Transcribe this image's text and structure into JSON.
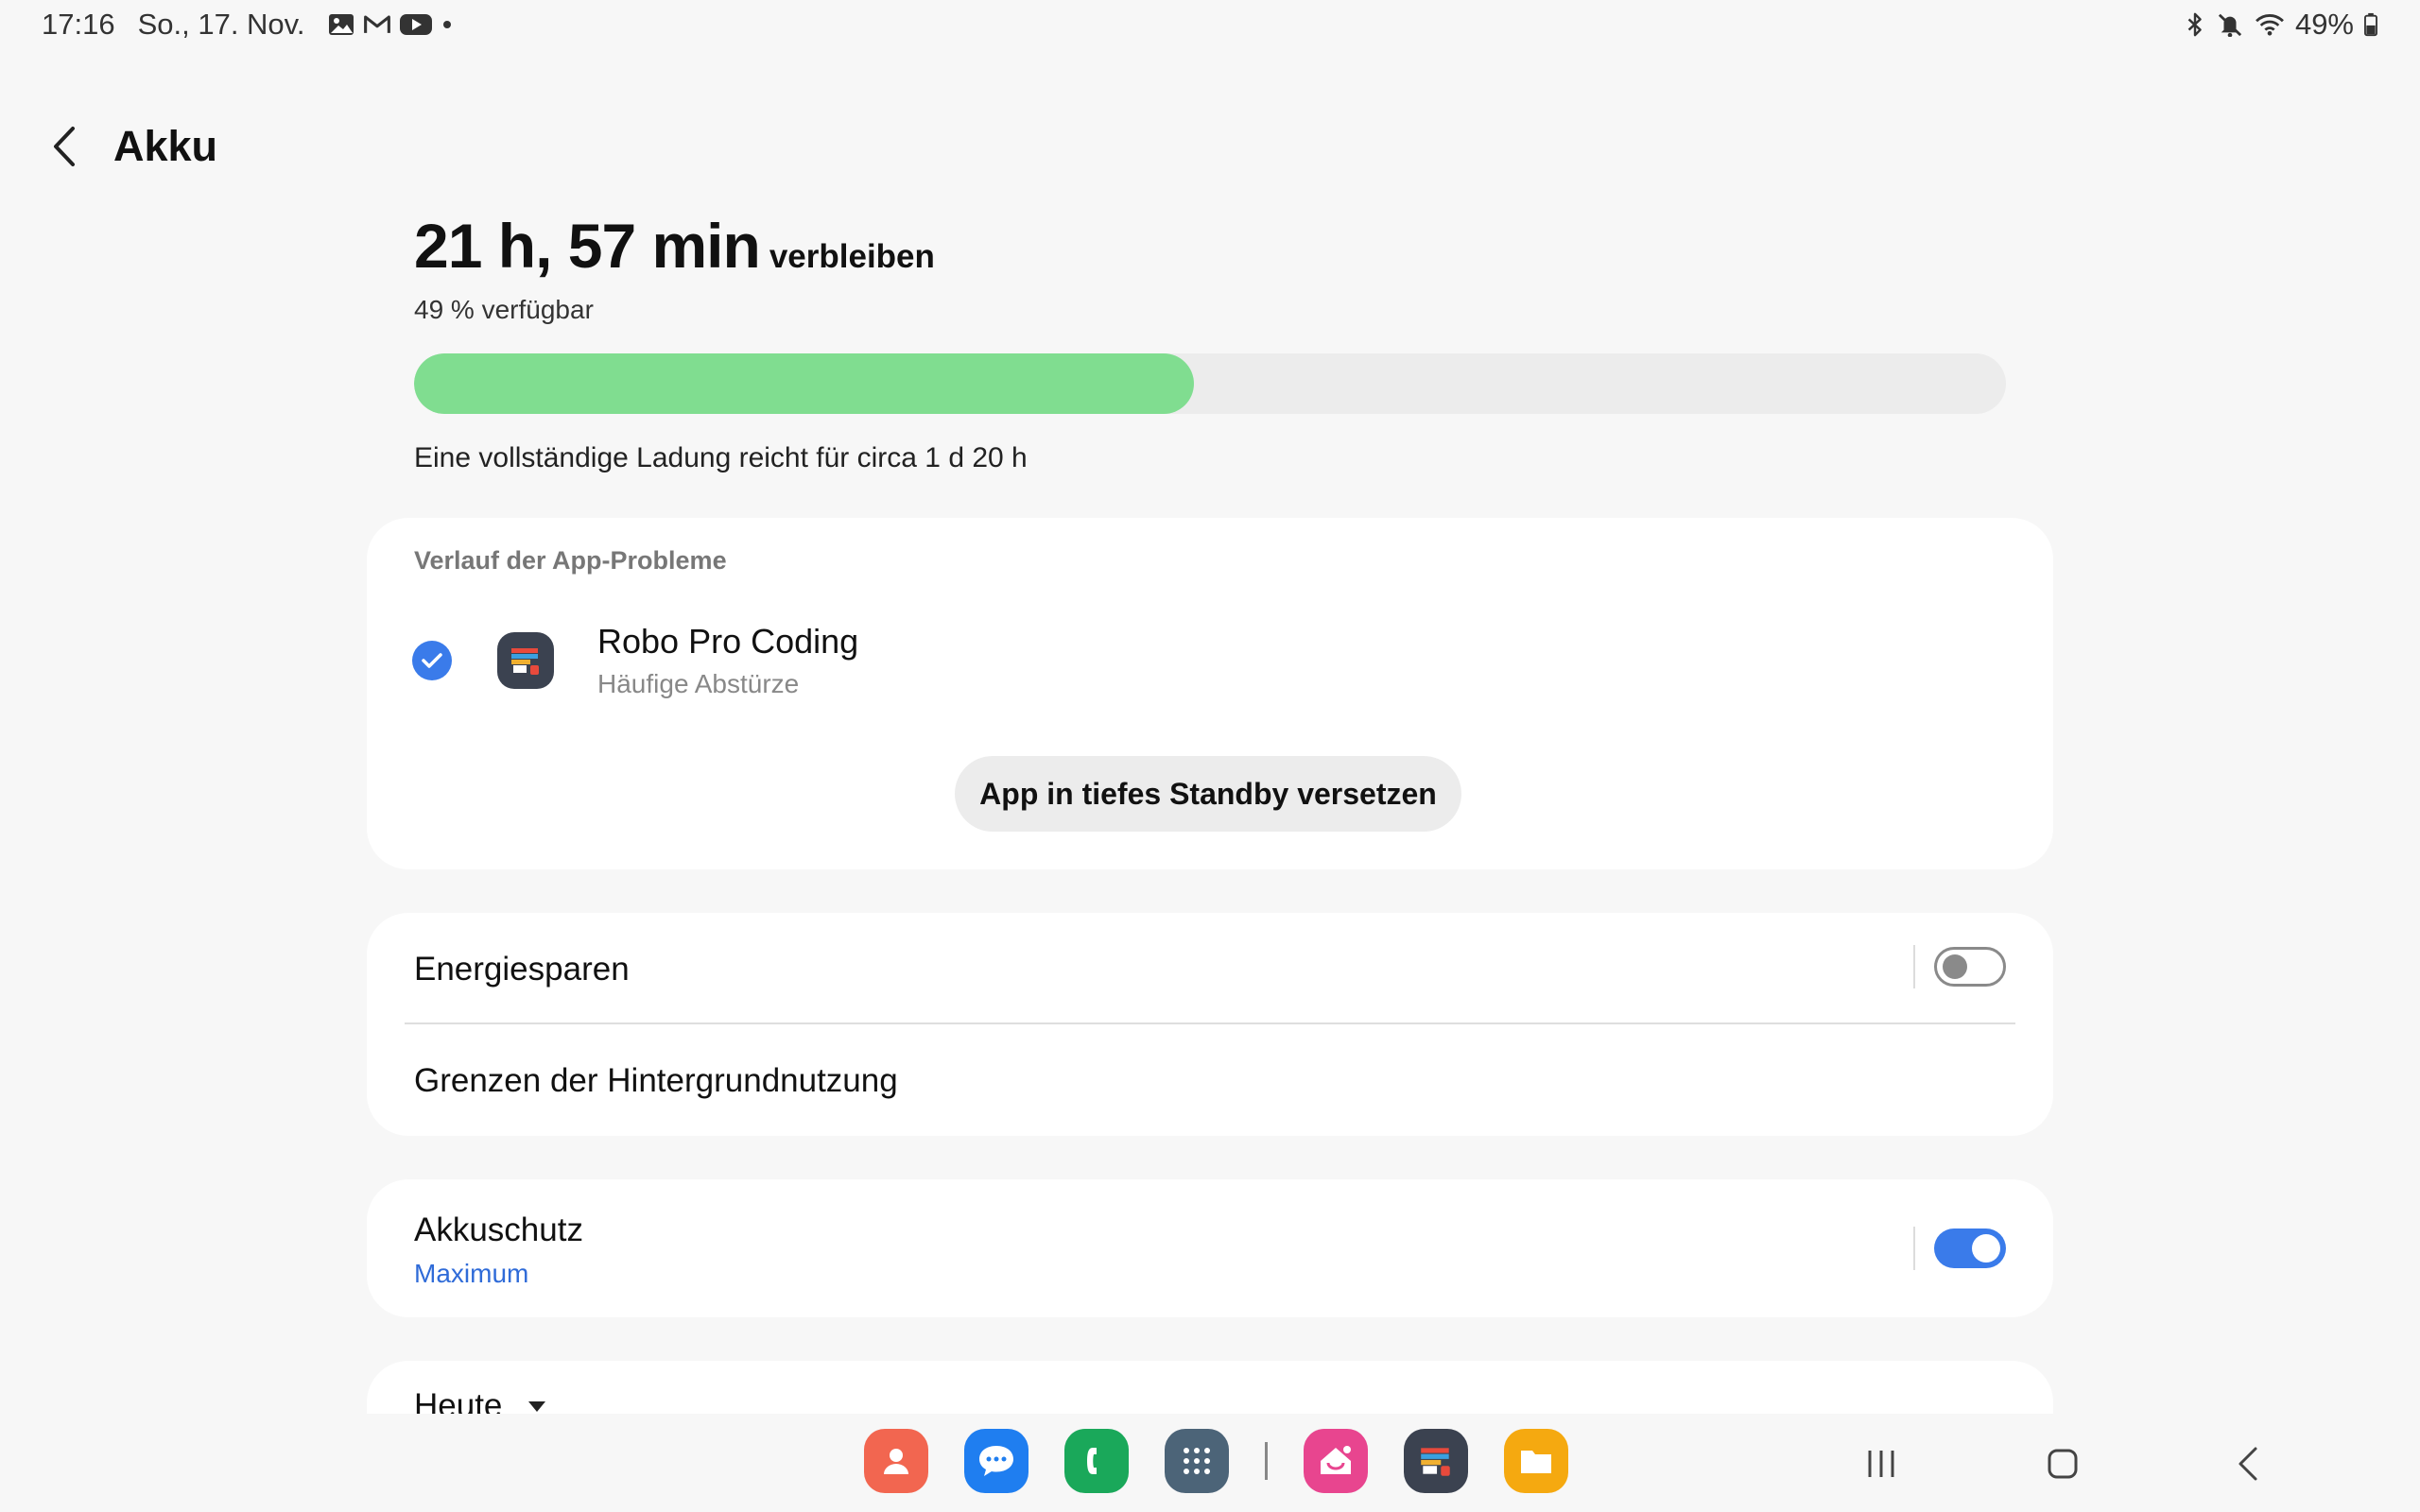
{
  "status_bar": {
    "time": "17:16",
    "date": "So., 17. Nov.",
    "notification_icons": [
      "gallery-icon",
      "gmail-icon",
      "youtube-icon",
      "more-dot-icon"
    ],
    "system_icons": [
      "bluetooth-icon",
      "mute-icon",
      "wifi-icon"
    ],
    "battery_percent": "49%"
  },
  "header": {
    "title": "Akku",
    "back_icon": "back-chevron-icon"
  },
  "battery": {
    "remaining_time": "21 h, 57 min",
    "remaining_suffix": "verbleiben",
    "available": "49 % verfügbar",
    "level_fraction": 0.49,
    "fill_color": "#80dd90",
    "full_charge_text": "Eine vollständige Ladung reicht für circa 1 d 20 h"
  },
  "app_issues": {
    "section_label": "Verlauf der App-Probleme",
    "app": {
      "name": "Robo Pro Coding",
      "issue": "Häufige Abstürze",
      "checked": true
    },
    "action_button": "App in tiefes Standby versetzen"
  },
  "power": {
    "power_saving_label": "Energiesparen",
    "power_saving_on": false,
    "background_limits_label": "Grenzen der Hintergrundnutzung"
  },
  "protection": {
    "label": "Akkuschutz",
    "value": "Maximum",
    "enabled": true,
    "accent_color": "#3a7bea"
  },
  "usage": {
    "period_label": "Heute"
  },
  "dock": {
    "apps": [
      "contacts-icon",
      "messages-icon",
      "phone-icon",
      "app-drawer-icon",
      "smartthings-icon",
      "robo-pro-coding-icon",
      "my-files-icon"
    ]
  },
  "nav": {
    "buttons": [
      "recents-button",
      "home-button",
      "back-button"
    ]
  }
}
